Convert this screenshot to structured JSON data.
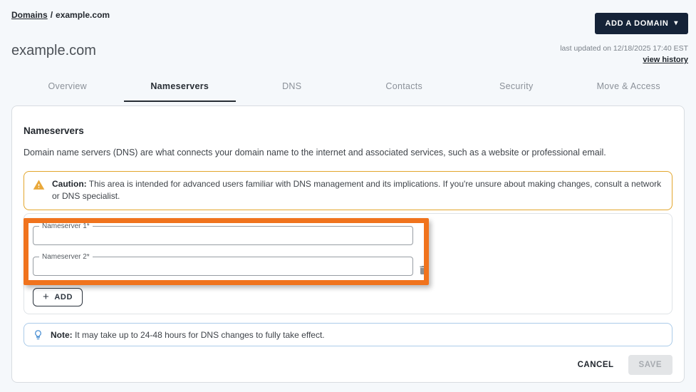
{
  "breadcrumb": {
    "link": "Domains",
    "separator": "/",
    "current": "example.com"
  },
  "header": {
    "add_domain_button": "ADD A DOMAIN",
    "title": "example.com",
    "last_updated": "last updated on 12/18/2025 17:40 EST",
    "view_history": "view history"
  },
  "icons": {
    "caret_down": "▾",
    "plus": "+"
  },
  "tabs": [
    {
      "label": "Overview",
      "active": false
    },
    {
      "label": "Nameservers",
      "active": true
    },
    {
      "label": "DNS",
      "active": false
    },
    {
      "label": "Contacts",
      "active": false
    },
    {
      "label": "Security",
      "active": false
    },
    {
      "label": "Move & Access",
      "active": false
    }
  ],
  "content": {
    "section_title": "Nameservers",
    "description": "Domain name servers (DNS) are what connects your domain name to the internet and associated services, such as a website or professional email.",
    "caution": {
      "label": "Caution:",
      "text": " This area is intended for advanced users familiar with DNS management and its implications. If you're unsure about making changes, consult a network or DNS specialist."
    },
    "fields": [
      {
        "label": "Nameserver 1*",
        "value": ""
      },
      {
        "label": "Nameserver 2*",
        "value": ""
      }
    ],
    "add_button": "ADD",
    "note": {
      "label": "Note:",
      "text": " It may take up to 24-48 hours for DNS changes to fully take effect."
    },
    "cancel_button": "CANCEL",
    "save_button": "SAVE"
  },
  "colors": {
    "accent_highlight": "#f0731d",
    "caution_border": "#e3a62c",
    "note_border": "#abcbe9",
    "primary_button_bg": "#152338",
    "active_tab": "#272d34"
  }
}
